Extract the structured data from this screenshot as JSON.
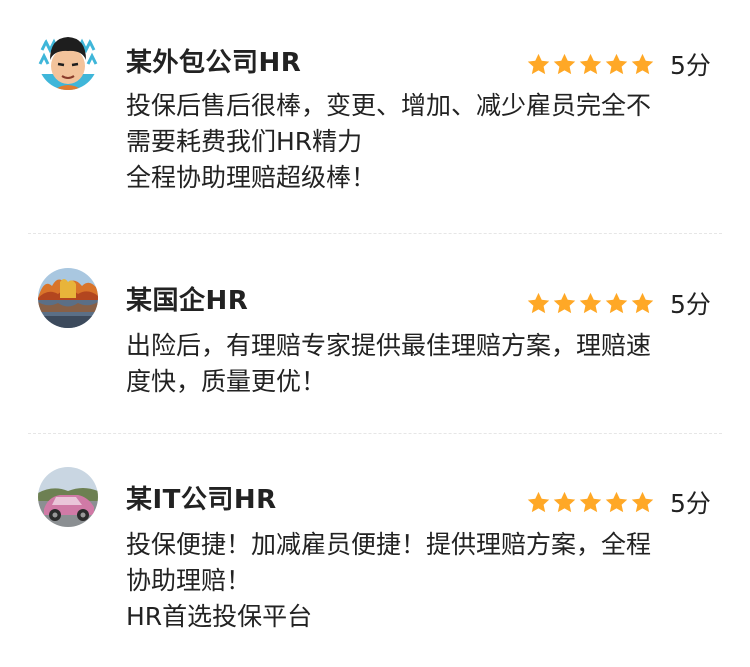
{
  "reviews": [
    {
      "name": "某外包公司HR",
      "stars": 5,
      "score": "5分",
      "lines": [
        "投保后售后很棒，变更、增加、减少雇员完全不",
        "需要耗费我们HR精力",
        "全程协助理赔超级棒！"
      ]
    },
    {
      "name": "某国企HR",
      "stars": 5,
      "score": "5分",
      "lines": [
        "出险后，有理赔专家提供最佳理赔方案，理赔速",
        "度快，质量更优！"
      ]
    },
    {
      "name": "某IT公司HR",
      "stars": 5,
      "score": "5分",
      "lines": [
        "投保便捷！加减雇员便捷！提供理赔方案，全程",
        "协助理赔！",
        "HR首选投保平台"
      ]
    }
  ],
  "colors": {
    "star": "#ffa826",
    "text": "#222222",
    "divider": "#e6e6e6"
  },
  "icons": [
    "cartoon-avatar-icon",
    "autumn-lake-avatar-icon",
    "pink-car-avatar-icon",
    "star-icon"
  ]
}
